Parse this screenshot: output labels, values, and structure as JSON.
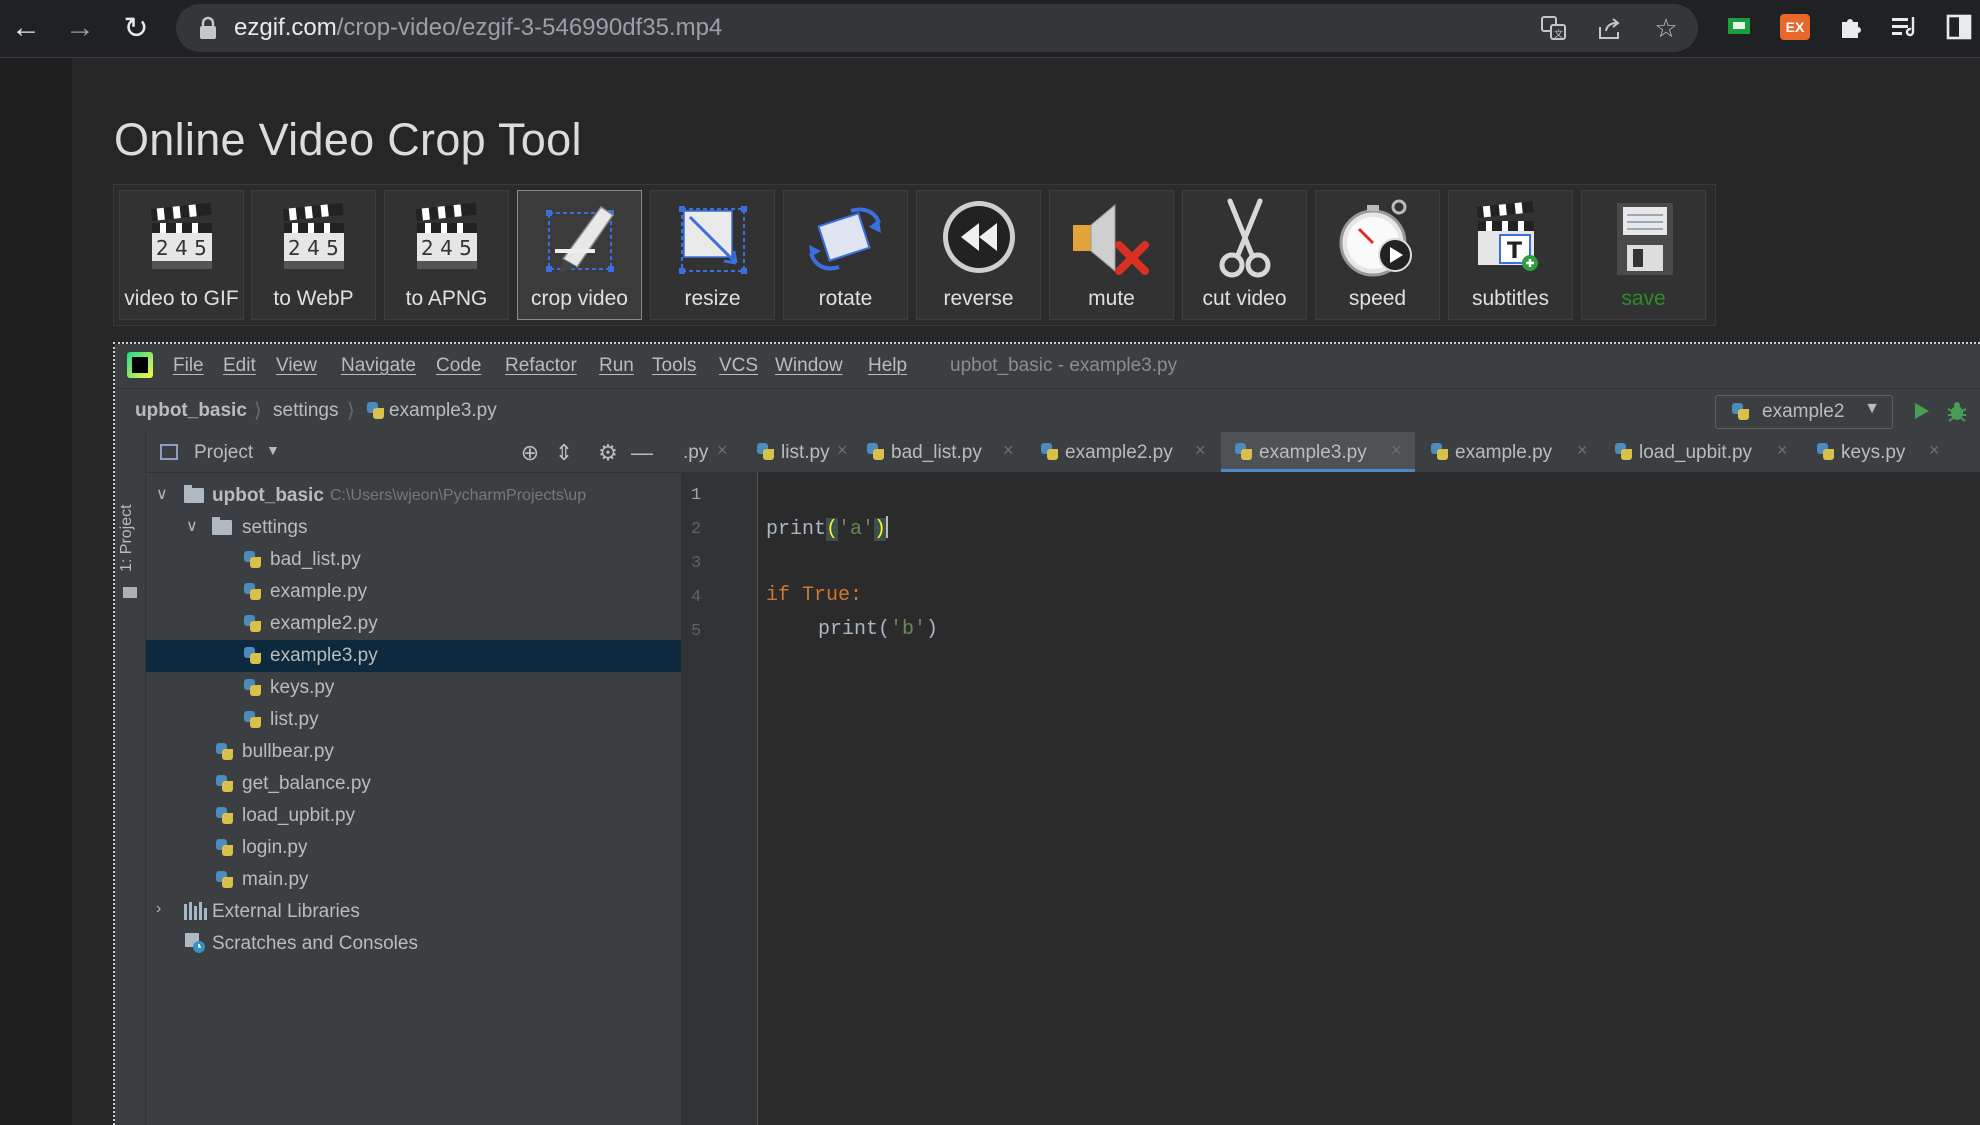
{
  "browser": {
    "url_host": "ezgif.com",
    "url_path": "/crop-video/ezgif-3-546990df35.mp4",
    "icons": [
      "back-icon",
      "forward-icon",
      "reload-icon",
      "lock-icon",
      "translate-icon",
      "share-icon",
      "star-icon",
      "extension-green-icon",
      "extension-ex-icon",
      "puzzle-icon",
      "reading-list-icon",
      "sidepanel-icon"
    ],
    "ex_badge": "EX"
  },
  "page": {
    "title": "Online Video Crop Tool",
    "tools": [
      {
        "label": "video to GIF",
        "icon": "clapperboard-icon"
      },
      {
        "label": "to WebP",
        "icon": "clapperboard-icon"
      },
      {
        "label": "to APNG",
        "icon": "clapperboard-icon"
      },
      {
        "label": "crop video",
        "icon": "crop-pen-icon",
        "active": true
      },
      {
        "label": "resize",
        "icon": "resize-icon"
      },
      {
        "label": "rotate",
        "icon": "rotate-icon"
      },
      {
        "label": "reverse",
        "icon": "rewind-icon"
      },
      {
        "label": "mute",
        "icon": "speaker-mute-icon"
      },
      {
        "label": "cut video",
        "icon": "scissors-icon"
      },
      {
        "label": "speed",
        "icon": "stopwatch-icon"
      },
      {
        "label": "subtitles",
        "icon": "subtitles-icon"
      },
      {
        "label": "save",
        "icon": "floppy-disk-icon"
      }
    ]
  },
  "ide": {
    "menu": [
      "File",
      "Edit",
      "View",
      "Navigate",
      "Code",
      "Refactor",
      "Run",
      "Tools",
      "VCS",
      "Window",
      "Help"
    ],
    "window_title": "upbot_basic - example3.py",
    "breadcrumb": [
      "upbot_basic",
      "settings",
      "example3.py"
    ],
    "run_config": "example2",
    "tool_strip_label": "1: Project",
    "project_title": "Project",
    "tree": [
      {
        "name": "upbot_basic",
        "path": "C:\\Users\\wjeon\\PycharmProjects\\up",
        "type": "root"
      },
      {
        "name": "settings",
        "type": "folder"
      },
      {
        "name": "bad_list.py",
        "type": "file"
      },
      {
        "name": "example.py",
        "type": "file"
      },
      {
        "name": "example2.py",
        "type": "file"
      },
      {
        "name": "example3.py",
        "type": "file",
        "selected": true
      },
      {
        "name": "keys.py",
        "type": "file"
      },
      {
        "name": "list.py",
        "type": "file"
      },
      {
        "name": "bullbear.py",
        "type": "file"
      },
      {
        "name": "get_balance.py",
        "type": "file"
      },
      {
        "name": "load_upbit.py",
        "type": "file"
      },
      {
        "name": "login.py",
        "type": "file"
      },
      {
        "name": "main.py",
        "type": "file"
      },
      {
        "name": "External Libraries",
        "type": "libs"
      },
      {
        "name": "Scratches and Consoles",
        "type": "scratches"
      }
    ],
    "tabs": [
      ".py",
      "list.py",
      "bad_list.py",
      "example2.py",
      "example3.py",
      "example.py",
      "load_upbit.py",
      "keys.py"
    ],
    "active_tab": "example3.py",
    "line_numbers": [
      "1",
      "2",
      "3",
      "4",
      "5"
    ],
    "code": {
      "l2_fn": "print",
      "l2_open": "(",
      "l2_str": "'a'",
      "l2_close": ")",
      "l4_kw": "if",
      "l4_kw2": "True",
      "l4_colon": ":",
      "l5_fn": "print",
      "l5_open": "(",
      "l5_str": "'b'",
      "l5_close": ")"
    }
  }
}
